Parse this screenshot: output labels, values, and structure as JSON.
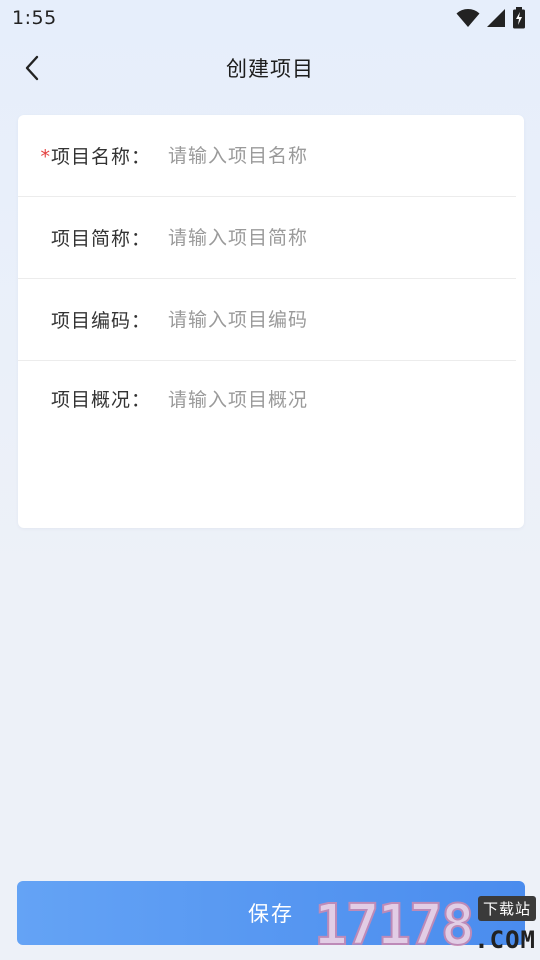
{
  "status_bar": {
    "time": "1:55",
    "icons": [
      "wifi-icon",
      "signal-icon",
      "battery-charging-icon"
    ]
  },
  "nav": {
    "back_icon": "chevron-left-icon",
    "title": "创建项目"
  },
  "form": {
    "fields": [
      {
        "label": "项目名称：",
        "required": true,
        "required_mark": "*",
        "placeholder": "请输入项目名称",
        "value": ""
      },
      {
        "label": "项目简称：",
        "required": false,
        "placeholder": "请输入项目简称",
        "value": ""
      },
      {
        "label": "项目编码：",
        "required": false,
        "placeholder": "请输入项目编码",
        "value": ""
      },
      {
        "label": "项目概况：",
        "required": false,
        "placeholder": "请输入项目概况",
        "value": ""
      }
    ]
  },
  "actions": {
    "save_label": "保存"
  },
  "watermark": {
    "digits": "17178",
    "suffix": ".COM",
    "badge": "下载站"
  },
  "colors": {
    "primary": "#4a8cee",
    "required": "#e3403f",
    "background": "#edf1f8"
  }
}
